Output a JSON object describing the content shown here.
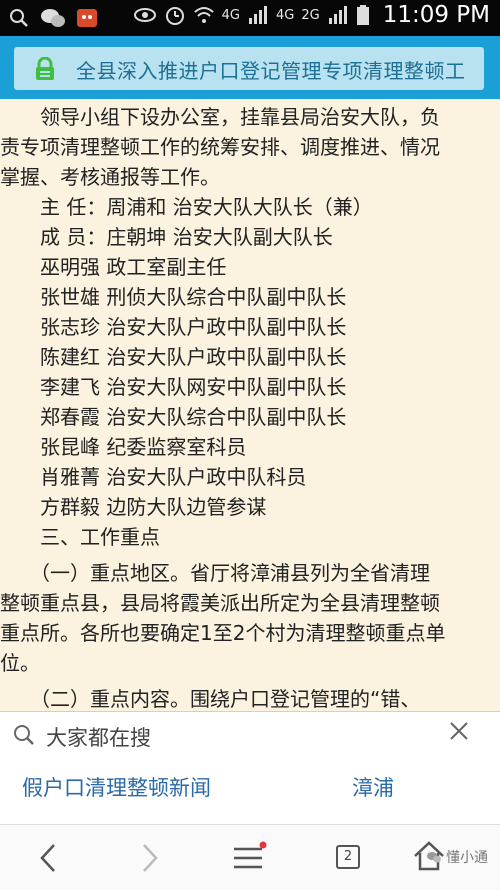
{
  "status_bar": {
    "time": "11:09 PM",
    "net1": "4G",
    "net2": "4G",
    "net3": "2G"
  },
  "url_bar": {
    "title": "全县深入推进户口登记管理专项清理整顿工"
  },
  "article": {
    "lines": [
      "　　领导小组下设办公室，挂靠县局治安大队，负",
      "责专项清理整顿工作的统筹安排、调度推进、情况",
      "掌握、考核通报等工作。",
      "　　主 任：周浦和 治安大队大队长（兼）",
      "　　成 员：庄朝坤 治安大队副大队长",
      "　　巫明强 政工室副主任",
      "　　张世雄 刑侦大队综合中队副中队长",
      "　　张志珍 治安大队户政中队副中队长",
      "　　陈建红 治安大队户政中队副中队长",
      "　　李建飞 治安大队网安中队副中队长",
      "　　郑春霞 治安大队综合中队副中队长",
      "　　张昆峰 纪委监察室科员",
      "　　肖雅菁 治安大队户政中队科员",
      "　　方群毅 边防大队边管参谋",
      "　　三、工作重点",
      "　　（一）重点地区。省厅将漳浦县列为全省清理",
      "整顿重点县，县局将霞美派出所定为全县清理整顿",
      "重点所。各所也要确定1至2个村为清理整顿重点单",
      "位。",
      "　　（二）重点内容。围绕户口登记管理的“错、"
    ]
  },
  "suggestions": {
    "label": "大家都在搜",
    "items": [
      "假户口清理整顿新闻",
      "漳浦"
    ]
  },
  "nav": {
    "tab_count": "2",
    "watermark": "懂小通"
  }
}
